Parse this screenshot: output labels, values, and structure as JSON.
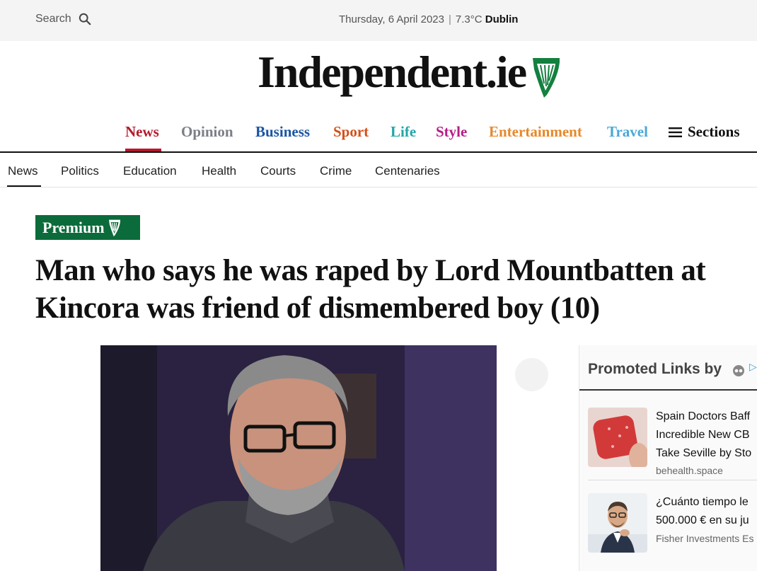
{
  "topbar": {
    "search_label": "Search",
    "date": "Thursday, 6 April 2023",
    "temperature": "7.3°C",
    "city": "Dublin"
  },
  "logo": {
    "text": "Independent.ie"
  },
  "main_nav": {
    "items": [
      {
        "label": "News",
        "color": "#b6182b"
      },
      {
        "label": "Opinion",
        "color": "#7b7f86"
      },
      {
        "label": "Business",
        "color": "#1a55a3"
      },
      {
        "label": "Sport",
        "color": "#d2501a"
      },
      {
        "label": "Life",
        "color": "#22a6a8"
      },
      {
        "label": "Style",
        "color": "#b61d86"
      },
      {
        "label": "Entertainment",
        "color": "#e7882a"
      },
      {
        "label": "Travel",
        "color": "#4aa8d8"
      }
    ],
    "sections_label": "Sections",
    "active": "News"
  },
  "sub_nav": {
    "items": [
      "News",
      "Politics",
      "Education",
      "Health",
      "Courts",
      "Crime",
      "Centenaries"
    ],
    "active": "News"
  },
  "article": {
    "badge": "Premium",
    "headline": "Man who says he was raped by Lord Mountbatten at Kincora was friend of dismembered boy (10)"
  },
  "promoted": {
    "title": "Promoted Links by",
    "items": [
      {
        "title_lines": [
          "Spain Doctors Baff",
          "Incredible New CB",
          "Take Seville by Sto"
        ],
        "source": "behealth.space",
        "thumb_icon": "gummy-candy-image"
      },
      {
        "title_lines": [
          "¿Cuánto tiempo le",
          "500.000 € en su ju"
        ],
        "source": "Fisher Investments Es",
        "thumb_icon": "businessman-photo"
      }
    ]
  },
  "colors": {
    "accent": "#b6182b",
    "premium_green": "#0b6b3a",
    "harp_green": "#14803f"
  }
}
